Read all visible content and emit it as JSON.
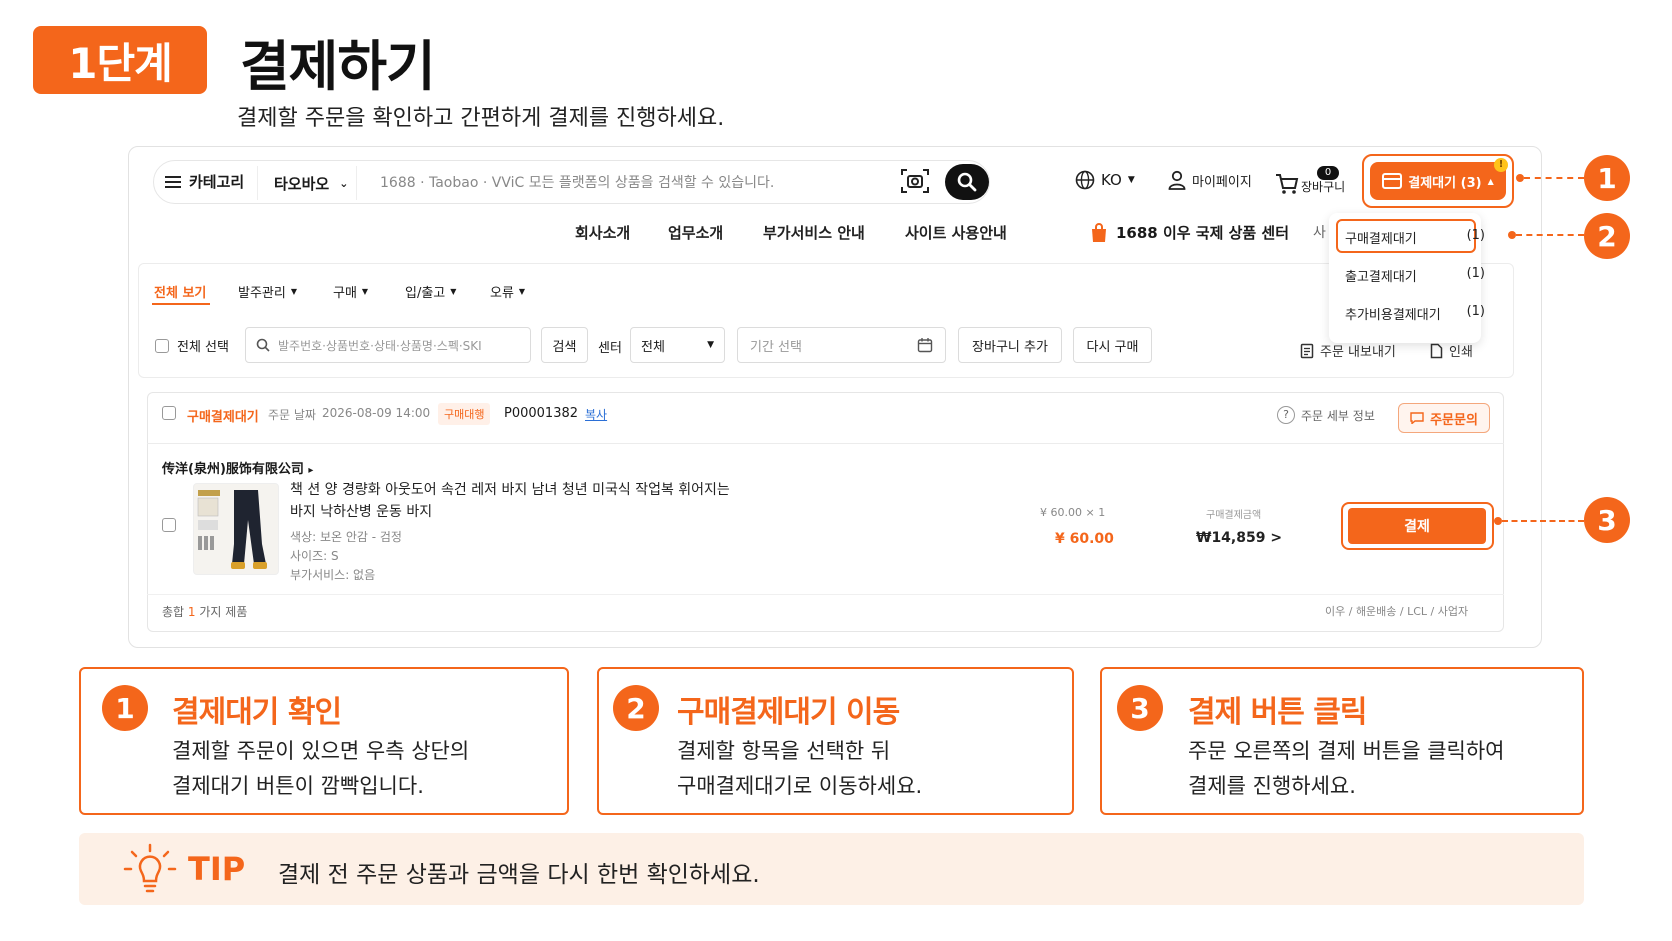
{
  "header": {
    "step_badge": "1단계",
    "title": "결제하기",
    "subtitle": "결제할 주문을 확인하고 간편하게 결제를 진행하세요."
  },
  "topbar": {
    "category_label": "카테고리",
    "site_select": "타오바오",
    "search_placeholder": "1688 · Taobao · VViC 모든 플랫폼의 상품을 검색할 수 있습니다.",
    "lang": "KO",
    "mypage": "마이페이지",
    "cart_label": "장바구니",
    "cart_count": "0",
    "pay_wait_label": "결제대기 (3)",
    "notif": "!"
  },
  "nav": {
    "items": [
      "회사소개",
      "업무소개",
      "부가서비스 안내",
      "사이트 사용안내"
    ],
    "center_link": "1688 이우 국제 상품 센터",
    "truncated": "사"
  },
  "dropdown": {
    "items": [
      {
        "label": "구매결제대기",
        "count": "(1)"
      },
      {
        "label": "출고결제대기",
        "count": "(1)"
      },
      {
        "label": "추가비용결제대기",
        "count": "(1)"
      }
    ]
  },
  "tabs": {
    "items": [
      "전체 보기",
      "발주관리",
      "구매",
      "입/출고",
      "오류"
    ]
  },
  "filters": {
    "select_all": "전체 선택",
    "search_placeholder": "발주번호·상품번호·상태·상품명·스펙·SKI",
    "search_btn": "검색",
    "center_label": "센터",
    "center_value": "전체",
    "date_placeholder": "기간 선택",
    "add_cart": "장바구니 추가",
    "reorder": "다시 구매",
    "export": "주문 내보내기",
    "print": "인쇄"
  },
  "order": {
    "status": "구매결제대기",
    "date_label": "주문 날짜",
    "date": "2026-08-09 14:00",
    "tag": "구매대행",
    "order_no": "P00001382",
    "copy": "복사",
    "detail": "주문 세부 정보",
    "inquiry": "주문문의",
    "seller": "传洋(泉州)服饰有限公司",
    "product_title": "책 션 양 경량화 아웃도어 속건 레저 바지 남녀 청년 미국식 작업복 휘어지는 바지 낙하산병 운동 바지",
    "opt_color": "색상: 보온 안감 - 검정",
    "opt_size": "사이즈: S",
    "opt_extra": "부가서비스: 없음",
    "unit_price": "¥ 60.00 × 1",
    "price_cny": "¥ 60.00",
    "amount_label": "구매결제금액",
    "amount_krw": "₩14,859 >",
    "pay_btn": "결제",
    "total_prefix": "총합",
    "total_count": "1",
    "total_suffix": "가지 제품",
    "shipping_info": "이우 / 해운배송 / LCL / 사업자"
  },
  "callouts": [
    "1",
    "2",
    "3"
  ],
  "steps": [
    {
      "num": "1",
      "title": "결제대기 확인",
      "line1": "결제할 주문이 있으면 우측 상단의",
      "line2": "결제대기 버튼이 깜빡입니다."
    },
    {
      "num": "2",
      "title": "구매결제대기 이동",
      "line1": "결제할 항목을 선택한 뒤",
      "line2": "구매결제대기로 이동하세요."
    },
    {
      "num": "3",
      "title": "결제 버튼 클릭",
      "line1": "주문 오른쪽의 결제 버튼을 클릭하여",
      "line2": "결제를 진행하세요."
    }
  ],
  "tip": {
    "label": "TIP",
    "text": "결제 전 주문 상품과 금액을 다시 한번 확인하세요."
  },
  "colors": {
    "accent": "#f4661b",
    "tip_bg": "#fdf0e6"
  }
}
